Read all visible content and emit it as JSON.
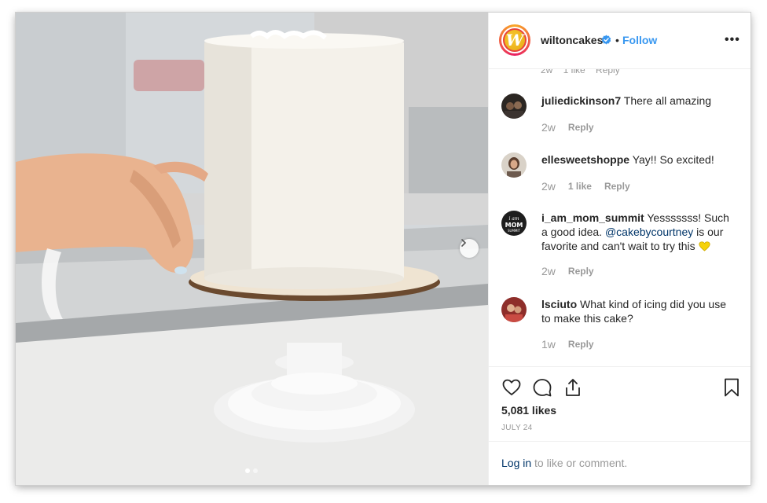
{
  "post": {
    "username": "wiltoncakes",
    "separator": "•",
    "follow_label": "Follow",
    "more_label": "•••",
    "partial_meta": "2w    1 like    Reply",
    "comments": [
      {
        "user": "juliedickinson7",
        "text": "There all amazing",
        "time": "2w",
        "likes": "",
        "reply": "Reply"
      },
      {
        "user": "ellesweetshoppe",
        "text": "Yay!! So excited!",
        "time": "2w",
        "likes": "1 like",
        "reply": "Reply"
      },
      {
        "user": "i_am_mom_summit",
        "text_before": "Yesssssss! Such a good idea.",
        "mention": "@cakebycourtney",
        "text_after": "is our favorite and can't wait to try this",
        "time": "2w",
        "likes": "",
        "reply": "Reply"
      },
      {
        "user": "lsciuto",
        "text": "What kind of icing did you use to make this cake?",
        "time": "1w",
        "likes": "",
        "reply": "Reply"
      }
    ],
    "likes": "5,081 likes",
    "date": "JULY 24",
    "login_link": "Log in",
    "login_rest": "to like or comment.",
    "carousel": {
      "slides": 2,
      "active": 1
    }
  },
  "icons": {
    "heart": "heart-icon",
    "comment": "comment-icon",
    "share": "share-icon",
    "bookmark": "bookmark-icon",
    "verified": "verified-badge-icon",
    "next": "chevron-right-icon"
  },
  "colors": {
    "link_blue": "#3897f0",
    "mention_blue": "#003569",
    "muted": "#999999",
    "text": "#262626",
    "emoji_heart": "#f5d20b"
  }
}
